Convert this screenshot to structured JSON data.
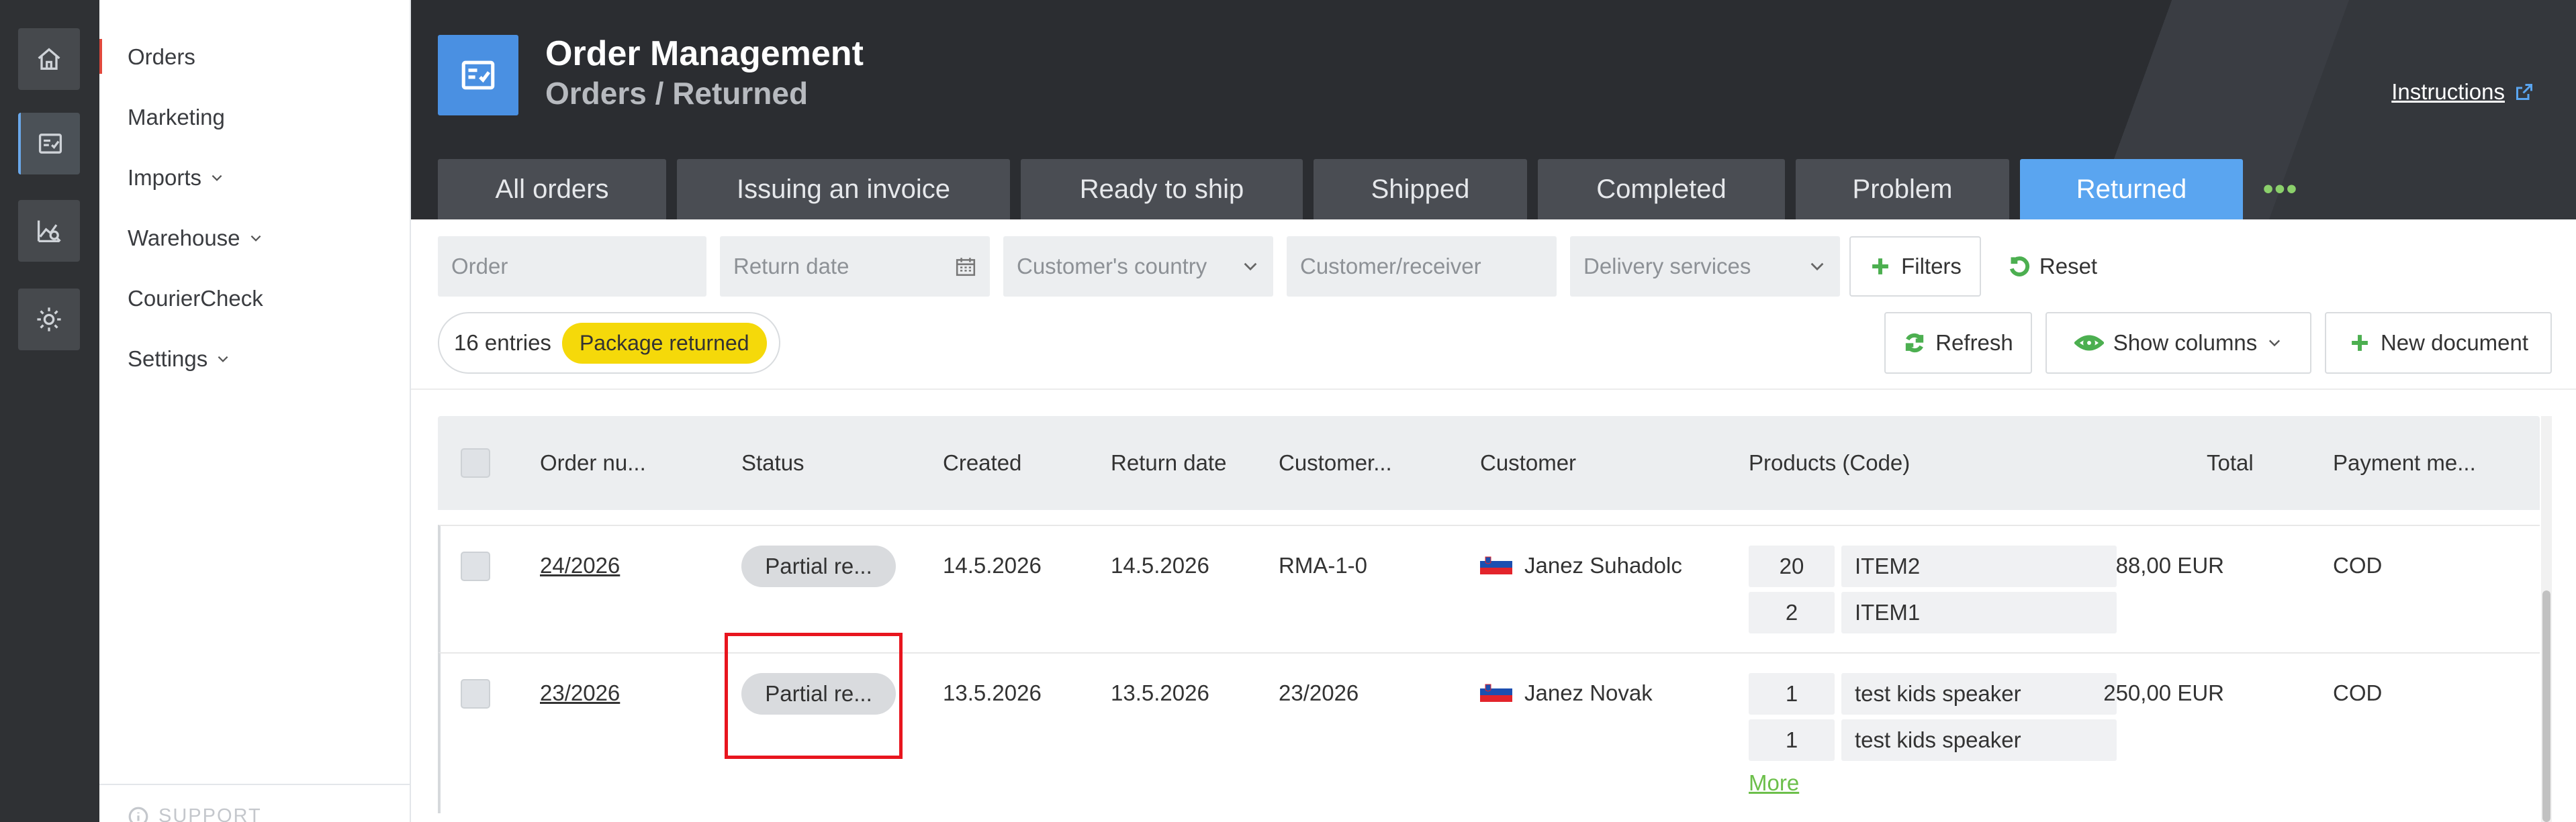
{
  "rail": {
    "icons": [
      "home-icon",
      "order-management-icon",
      "analytics-icon",
      "settings-gear-icon"
    ],
    "active_index": 1
  },
  "menu": {
    "items": [
      {
        "label": "Orders",
        "has_chevron": false,
        "active": true
      },
      {
        "label": "Marketing",
        "has_chevron": false
      },
      {
        "label": "Imports",
        "has_chevron": true
      },
      {
        "label": "Warehouse",
        "has_chevron": true
      },
      {
        "label": "CourierCheck",
        "has_chevron": false
      },
      {
        "label": "Settings",
        "has_chevron": true
      }
    ],
    "support_label": "SUPPORT"
  },
  "header": {
    "title": "Order Management",
    "breadcrumb": "Orders / Returned",
    "instructions_label": "Instructions"
  },
  "tabs": [
    {
      "label": "All orders"
    },
    {
      "label": "Issuing an invoice"
    },
    {
      "label": "Ready to ship"
    },
    {
      "label": "Shipped"
    },
    {
      "label": "Completed"
    },
    {
      "label": "Problem"
    },
    {
      "label": "Returned",
      "active": true
    }
  ],
  "tabs_more_label": "•••",
  "filters": {
    "order_placeholder": "Order",
    "return_date_placeholder": "Return date",
    "country_placeholder": "Customer's country",
    "customer_placeholder": "Customer/receiver",
    "delivery_placeholder": "Delivery services",
    "filters_label": "Filters",
    "reset_label": "Reset"
  },
  "summary": {
    "entries": "16 entries",
    "status_filter": "Package returned"
  },
  "actions": {
    "refresh_label": "Refresh",
    "show_columns_label": "Show columns",
    "new_document_label": "New document"
  },
  "table": {
    "headers": {
      "order_number": "Order nu...",
      "status": "Status",
      "created": "Created",
      "return_date": "Return date",
      "customer_ref": "Customer...",
      "customer": "Customer",
      "products": "Products (Code)",
      "total": "Total",
      "payment": "Payment me..."
    },
    "rows": [
      {
        "order_number": "24/2026",
        "status": "Partial re...",
        "created": "14.5.2026",
        "return_date": "14.5.2026",
        "customer_ref": "RMA-1-0",
        "customer": "Janez Suhadolc",
        "products": [
          {
            "qty": "20",
            "name": "ITEM2"
          },
          {
            "qty": "2",
            "name": "ITEM1"
          }
        ],
        "total": "88,00 EUR",
        "payment": "COD"
      },
      {
        "order_number": "23/2026",
        "status": "Partial re...",
        "created": "13.5.2026",
        "return_date": "13.5.2026",
        "customer_ref": "23/2026",
        "customer": "Janez Novak",
        "products": [
          {
            "qty": "1",
            "name": "test kids speaker"
          },
          {
            "qty": "1",
            "name": "test kids speaker"
          }
        ],
        "more_label": "More",
        "total": "250,00 EUR",
        "payment": "COD"
      }
    ]
  },
  "colors": {
    "accent_blue": "#5aa5f0",
    "badge_yellow": "#f5d90a",
    "green": "#4caf50",
    "highlight_red": "#e8151e"
  }
}
